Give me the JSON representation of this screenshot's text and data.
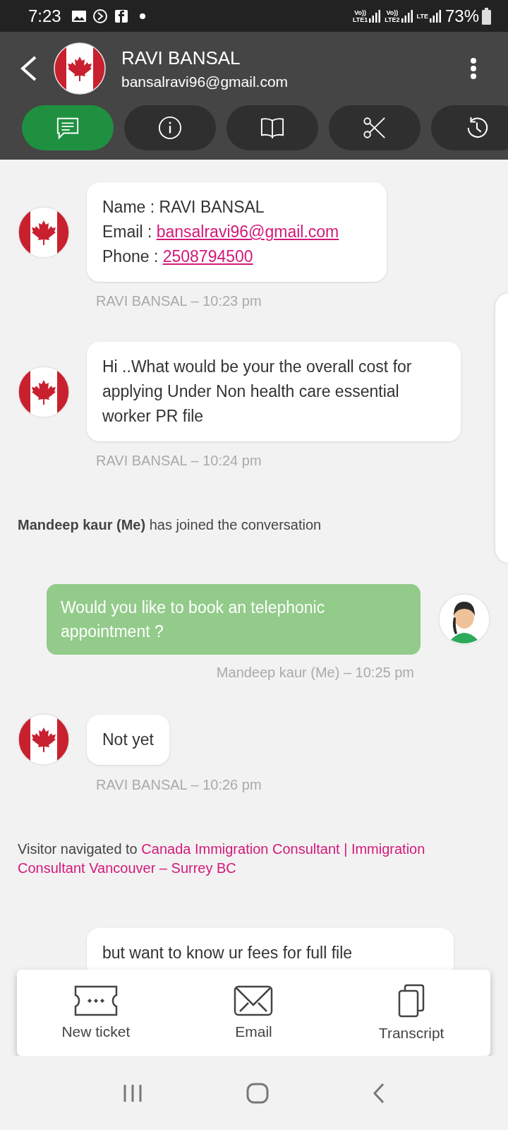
{
  "status_bar": {
    "time": "7:23",
    "sim_labels": [
      {
        "top": "Vo))",
        "bottom": "LTE1"
      },
      {
        "top": "Vo))",
        "bottom": "LTE2"
      },
      {
        "top": "LTE"
      }
    ],
    "battery": "73%"
  },
  "header": {
    "name": "RAVI BANSAL",
    "email": "bansalravi96@gmail.com"
  },
  "tabs": [
    {
      "kind": "chat",
      "selected": true
    },
    {
      "kind": "info",
      "selected": false
    },
    {
      "kind": "book",
      "selected": false
    },
    {
      "kind": "scissors",
      "selected": false
    },
    {
      "kind": "history",
      "selected": false
    }
  ],
  "messages": [
    {
      "kind": "card",
      "lines": [
        {
          "label": "Name : RAVI BANSAL"
        },
        {
          "label": "Email : ",
          "link": "bansalravi96@gmail.com"
        },
        {
          "label": "Phone : ",
          "link": "2508794500"
        }
      ],
      "meta": "RAVI BANSAL – 10:23 pm"
    },
    {
      "kind": "incoming",
      "text": "Hi ..What would be your the overall cost for applying Under Non health care essential worker PR file",
      "meta": "RAVI BANSAL – 10:24 pm"
    },
    {
      "kind": "event",
      "text": "**Mandeep kaur (Me)** has joined the conversation"
    },
    {
      "kind": "outgoing",
      "text": "Would you like to book an telephonic appointment ?",
      "meta": "Mandeep kaur (Me) – 10:25 pm"
    },
    {
      "kind": "incoming",
      "text": "Not yet",
      "meta": "RAVI BANSAL – 10:26 pm"
    },
    {
      "kind": "navigation",
      "text": "Visitor navigated to",
      "link_lines": [
        "Canada Immigration Consultant | Immigration",
        "Consultant Vancouver – Surrey BC"
      ]
    },
    {
      "kind": "incoming",
      "text": "but want to know ur fees for full file"
    }
  ],
  "actions": [
    {
      "kind": "ticket",
      "label": "New ticket"
    },
    {
      "kind": "email",
      "label": "Email"
    },
    {
      "kind": "copy",
      "label": "Transcript"
    }
  ]
}
